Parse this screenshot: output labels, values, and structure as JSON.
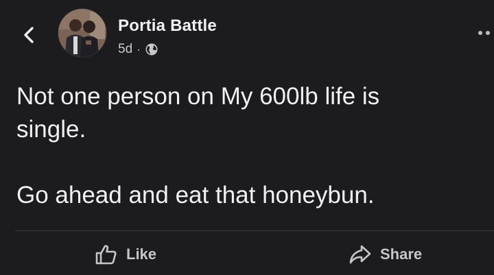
{
  "header": {
    "back_icon": "chevron-left-icon",
    "author_name": "Portia Battle",
    "timestamp": "5d",
    "separator": "·",
    "privacy_icon": "globe-icon",
    "more_icon": "more-dots-icon"
  },
  "post": {
    "line1": "Not one person on My 600lb life is",
    "line2": "single.",
    "line3": "Go ahead and eat that honeybun."
  },
  "actions": {
    "like_label": "Like",
    "like_icon": "thumbs-up-icon",
    "share_label": "Share",
    "share_icon": "share-arrow-icon"
  },
  "colors": {
    "background": "#1c1c1e",
    "text": "#f1f1f3",
    "muted": "#c6c6c9",
    "divider": "#3a3a3d"
  }
}
